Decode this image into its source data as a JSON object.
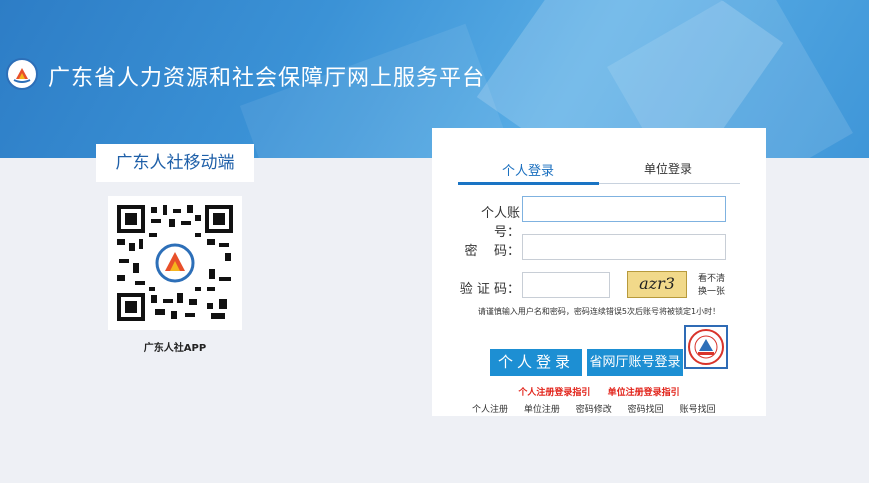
{
  "header": {
    "title": "广东省人力资源和社会保障厅网上服务平台"
  },
  "mobile": {
    "tab_label": "广东人社移动端",
    "app_label": "广东人社APP"
  },
  "login": {
    "tabs": [
      "个人登录",
      "单位登录"
    ],
    "account_label": "个人账号：",
    "password_label": "密    码：",
    "captcha_label": "验 证 码：",
    "captcha_text": "azr3",
    "refresh_text": "看不清换一张",
    "hint": "请谨慎输入用户名和密码，密码连续错误5次后账号将被锁定1小时！",
    "login_button": "个人登录",
    "gov_login_button": "省网厅账号登录",
    "guides": [
      "个人注册登录指引",
      "单位注册登录指引"
    ],
    "links": [
      "个人注册",
      "单位注册",
      "密码修改",
      "密码找回",
      "账号找回"
    ]
  },
  "colors": {
    "banner": "#3b92d6",
    "accent": "#1d8fd3",
    "guide_red": "#e2231a"
  },
  "icons": {
    "logo": "hrss-logo-icon",
    "seal": "seal-icon",
    "qr": "qr-code-icon"
  }
}
